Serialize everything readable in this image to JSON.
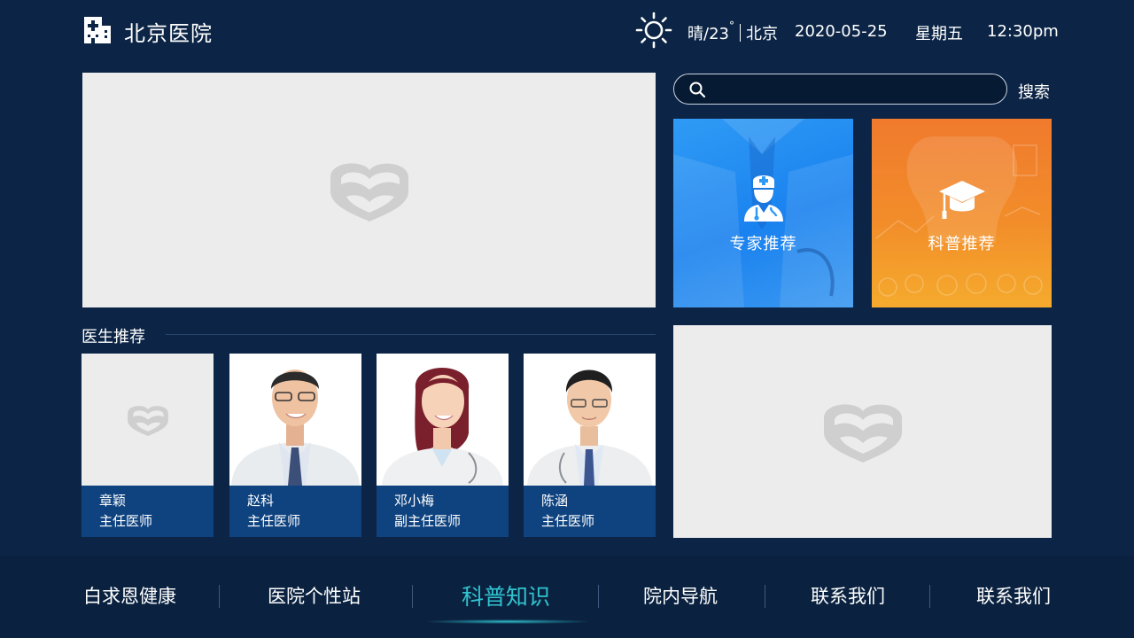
{
  "header": {
    "hospital_name": "北京医院",
    "logo_icon": "hospital-building-icon",
    "weather_icon": "sun-icon",
    "weather_condition": "晴/23",
    "degree_symbol": "°",
    "city": "北京",
    "date": "2020-05-25",
    "weekday": "星期五",
    "time": "12:30pm"
  },
  "search": {
    "placeholder": "",
    "value": "",
    "button_label": "搜索",
    "icon": "search-icon"
  },
  "tiles": [
    {
      "label": "专家推荐",
      "icon": "doctor-icon",
      "color": "#1a82ef"
    },
    {
      "label": "科普推荐",
      "icon": "graduation-cap-icon",
      "color": "#f28d2a"
    }
  ],
  "doctors_section": {
    "title": "医生推荐",
    "doctors": [
      {
        "name": "章颖",
        "title": "主任医师"
      },
      {
        "name": "赵科",
        "title": "主任医师"
      },
      {
        "name": "邓小梅",
        "title": "副主任医师"
      },
      {
        "name": "陈涵",
        "title": "主任医师"
      }
    ]
  },
  "nav": {
    "items": [
      {
        "label": "白求恩健康"
      },
      {
        "label": "医院个性站"
      },
      {
        "label": "科普知识",
        "active": true
      },
      {
        "label": "院内导航"
      },
      {
        "label": "联系我们"
      },
      {
        "label": "联系我们"
      }
    ],
    "active_color": "#31c3d0"
  },
  "colors": {
    "background": "#0c2546",
    "card_caption": "#0f437f",
    "placeholder": "#ececec"
  }
}
